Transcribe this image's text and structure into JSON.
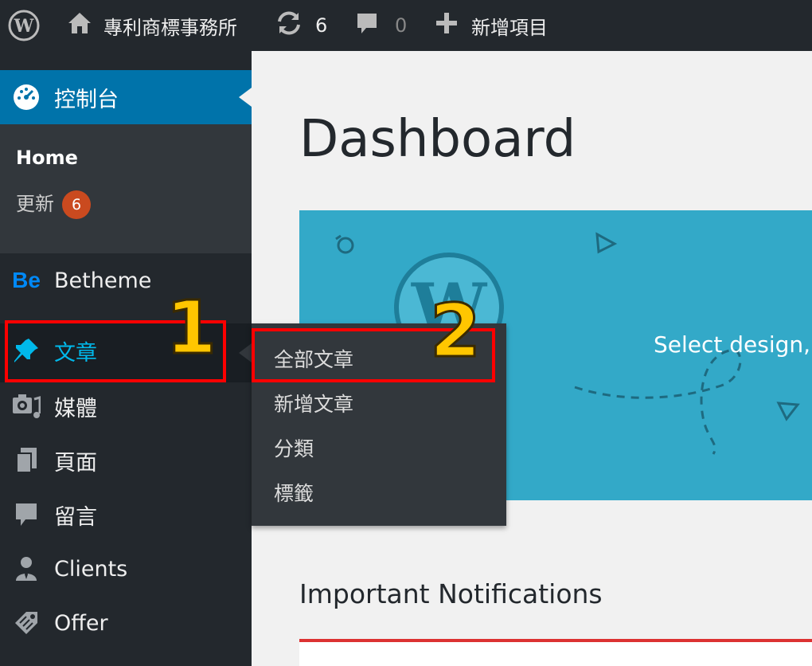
{
  "adminbar": {
    "site_name": "專利商標事務所",
    "updates_count": "6",
    "comments_count": "0",
    "new_label": "新增項目"
  },
  "sidebar": {
    "dashboard_label": "控制台",
    "submenu": {
      "home": "Home",
      "updates": "更新",
      "updates_badge": "6"
    },
    "items": [
      {
        "label": "Betheme",
        "icon": "betheme-logo-icon"
      },
      {
        "label": "文章",
        "icon": "pin-icon"
      },
      {
        "label": "媒體",
        "icon": "media-icon"
      },
      {
        "label": "頁面",
        "icon": "pages-icon"
      },
      {
        "label": "留言",
        "icon": "comment-icon"
      },
      {
        "label": "Clients",
        "icon": "user-icon"
      },
      {
        "label": "Offer",
        "icon": "tag-icon"
      }
    ],
    "betheme_icon_text": "Be"
  },
  "posts_flyout": {
    "items": [
      "全部文章",
      "新增文章",
      "分類",
      "標籤"
    ]
  },
  "annotations": {
    "step1": "1",
    "step2": "2"
  },
  "main": {
    "title": "Dashboard",
    "welcome_text": "Select design, fu",
    "notifications_title": "Important Notifications"
  },
  "colors": {
    "adminbar": "#23282d",
    "active_blue": "#0073aa",
    "highlight": "#00b9eb",
    "welcome_bg": "#33a9c8",
    "badge": "#ca4a1f",
    "annotation_red": "#ff0000",
    "annotation_yellow": "#ffc600"
  }
}
